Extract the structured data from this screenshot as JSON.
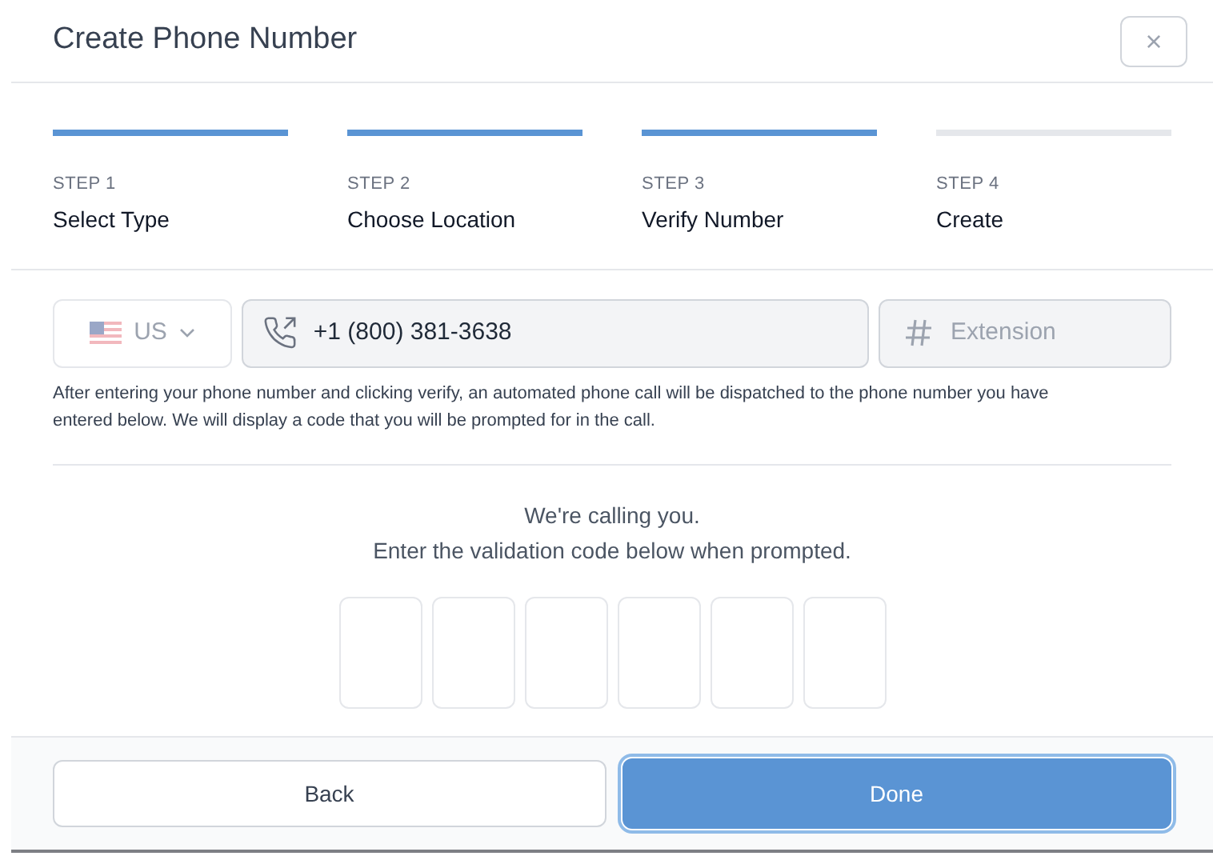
{
  "dialog": {
    "title": "Create Phone Number",
    "close_label": "×"
  },
  "steps": [
    {
      "label": "STEP 1",
      "name": "Select Type",
      "completed": true
    },
    {
      "label": "STEP 2",
      "name": "Choose Location",
      "completed": true
    },
    {
      "label": "STEP 3",
      "name": "Verify Number",
      "completed": true
    },
    {
      "label": "STEP 4",
      "name": "Create",
      "completed": false
    }
  ],
  "country": {
    "code": "US"
  },
  "phone": {
    "value": "+1 (800) 381-3638"
  },
  "extension": {
    "placeholder": "Extension"
  },
  "help_text": "After entering your phone number and clicking verify, an automated phone call will be dispatched to the phone number you have entered below. We will display a code that you will be prompted for in the call.",
  "calling": {
    "line1": "We're calling you.",
    "line2": "Enter the validation code below when prompted."
  },
  "code_boxes": [
    {
      "filled": false
    },
    {
      "filled": false
    },
    {
      "filled": false
    },
    {
      "filled": false
    },
    {
      "filled": false
    },
    {
      "filled": false
    }
  ],
  "buttons": [
    {
      "label": "Back",
      "kind": "secondary"
    },
    {
      "label": "Done",
      "kind": "primary"
    }
  ]
}
